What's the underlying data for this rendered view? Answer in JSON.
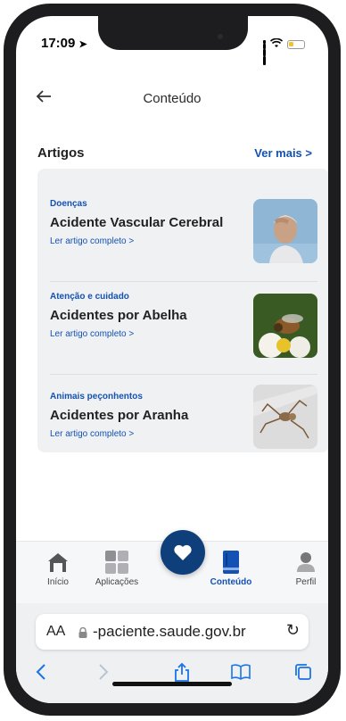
{
  "status": {
    "time": "17:09"
  },
  "header": {
    "title": "Conteúdo",
    "back_icon": "arrow-left-icon"
  },
  "section": {
    "title": "Artigos",
    "see_more": "Ver mais >"
  },
  "articles": [
    {
      "category": "Doenças",
      "title": "Acidente Vascular Cerebral",
      "link": "Ler artigo completo  >"
    },
    {
      "category": "Atenção e cuidado",
      "title": "Acidentes por Abelha",
      "link": "Ler artigo completo  >"
    },
    {
      "category": "Animais peçonhentos",
      "title": "Acidentes por Aranha",
      "link": "Ler artigo completo  >"
    }
  ],
  "tabs": [
    {
      "label": "Início",
      "icon": "home-icon"
    },
    {
      "label": "Aplicações",
      "icon": "apps-grid-icon"
    },
    {
      "label": "Conteúdo",
      "icon": "book-icon",
      "active": true
    },
    {
      "label": "Perfil",
      "icon": "user-icon"
    }
  ],
  "fab": {
    "icon": "heart-icon",
    "color": "#0f3f7a"
  },
  "browser": {
    "aa": "AA",
    "url": "-paciente.saude.gov.br"
  },
  "colors": {
    "accent": "#1351b4"
  }
}
